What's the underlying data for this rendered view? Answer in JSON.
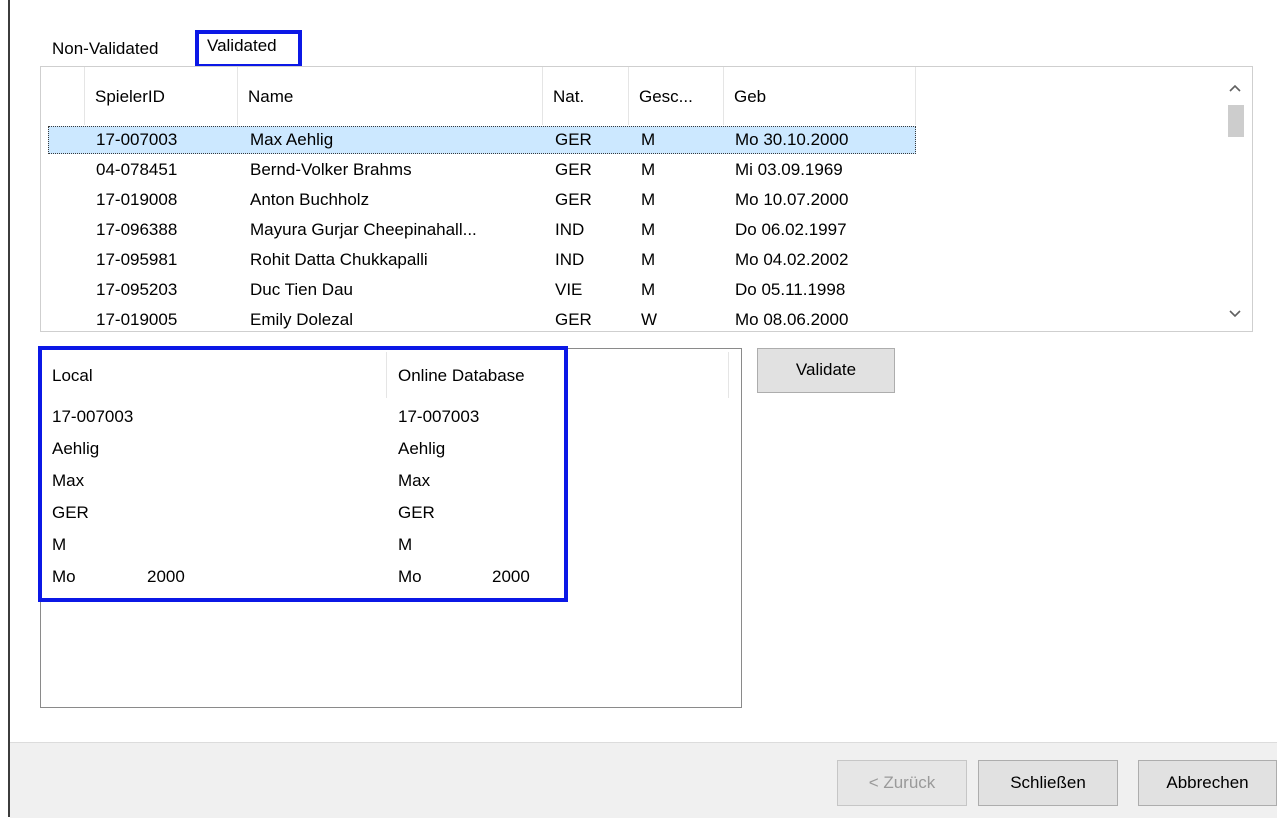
{
  "tabs": {
    "nonvalidated": "Non-Validated",
    "validated": "Validated"
  },
  "list": {
    "columns": [
      "SpielerID",
      "Name",
      "Nat.",
      "Gesc...",
      "Geb"
    ],
    "rows": [
      [
        "17-007003",
        "Max Aehlig",
        "GER",
        "M",
        "Mo 30.10.2000"
      ],
      [
        "04-078451",
        "Bernd-Volker Brahms",
        "GER",
        "M",
        "Mi 03.09.1969"
      ],
      [
        "17-019008",
        "Anton Buchholz",
        "GER",
        "M",
        "Mo 10.07.2000"
      ],
      [
        "17-096388",
        "Mayura Gurjar Cheepinahall...",
        "IND",
        "M",
        "Do 06.02.1997"
      ],
      [
        "17-095981",
        "Rohit Datta Chukkapalli",
        "IND",
        "M",
        "Mo 04.02.2002"
      ],
      [
        "17-095203",
        "Duc Tien Dau",
        "VIE",
        "M",
        "Do 05.11.1998"
      ],
      [
        "17-019005",
        "Emily Dolezal",
        "GER",
        "W",
        "Mo 08.06.2000"
      ]
    ],
    "selected_row": 0,
    "scroll_up_icon": "chevron-up-icon",
    "scroll_down_icon": "chevron-down-icon"
  },
  "compare": {
    "local_header": "Local",
    "online_header": "Online Database",
    "local": [
      "17-007003",
      "Aehlig",
      "Max",
      "GER",
      "M"
    ],
    "local_day": "Mo",
    "local_year": "2000",
    "online": [
      "17-007003",
      "Aehlig",
      "Max",
      "GER",
      "M"
    ],
    "online_day": "Mo",
    "online_year": "2000"
  },
  "buttons": {
    "validate": "Validate",
    "back": "< Zurück",
    "close": "Schließen",
    "cancel": "Abbrechen"
  },
  "colors": {
    "highlight_outline": "#0b18e6",
    "selection": "#cce8ff"
  }
}
